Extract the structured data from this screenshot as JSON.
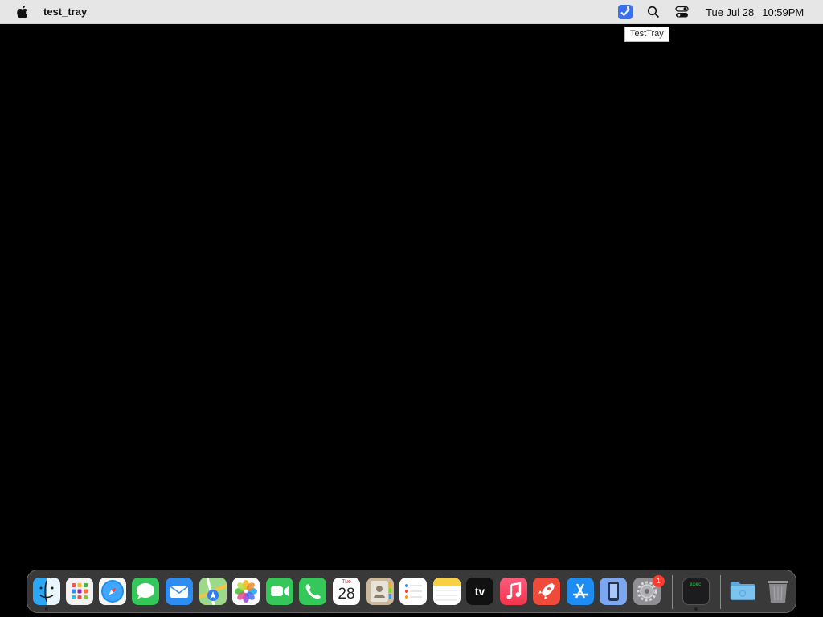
{
  "menubar": {
    "app_name": "test_tray",
    "clock_date": "Tue Jul 28",
    "clock_time": "10:59PM",
    "tray_tooltip": "TestTray"
  },
  "dock": {
    "items": [
      {
        "name": "Finder",
        "icon": "finder-icon",
        "running": true
      },
      {
        "name": "Launchpad",
        "icon": "launchpad-icon"
      },
      {
        "name": "Safari",
        "icon": "safari-icon"
      },
      {
        "name": "Messages",
        "icon": "messages-icon"
      },
      {
        "name": "Mail",
        "icon": "mail-icon"
      },
      {
        "name": "Maps",
        "icon": "maps-icon"
      },
      {
        "name": "Photos",
        "icon": "photos-icon"
      },
      {
        "name": "FaceTime",
        "icon": "facetime-icon"
      },
      {
        "name": "Phone",
        "icon": "phone-icon"
      },
      {
        "name": "Calendar",
        "icon": "calendar-icon",
        "day": "Tue",
        "date": "28"
      },
      {
        "name": "Contacts",
        "icon": "contacts-icon"
      },
      {
        "name": "Reminders",
        "icon": "reminders-icon"
      },
      {
        "name": "Notes",
        "icon": "notes-icon"
      },
      {
        "name": "TV",
        "icon": "tv-icon",
        "label": "tv"
      },
      {
        "name": "Music",
        "icon": "music-icon"
      },
      {
        "name": "Rocket",
        "icon": "rocket-icon"
      },
      {
        "name": "App Store",
        "icon": "app-store-icon"
      },
      {
        "name": "Simulator",
        "icon": "simulator-icon"
      },
      {
        "name": "System Settings",
        "icon": "settings-icon",
        "badge": "1"
      },
      {
        "name": "Terminal",
        "icon": "terminal-icon",
        "label": "exec",
        "running": true
      },
      {
        "name": "Downloads",
        "icon": "folder-icon"
      },
      {
        "name": "Trash",
        "icon": "trash-icon"
      }
    ]
  },
  "colors": {
    "menubar": "#e6e6e6",
    "tray_accent": "#3a6ff0",
    "badge": "#ff3b30"
  }
}
